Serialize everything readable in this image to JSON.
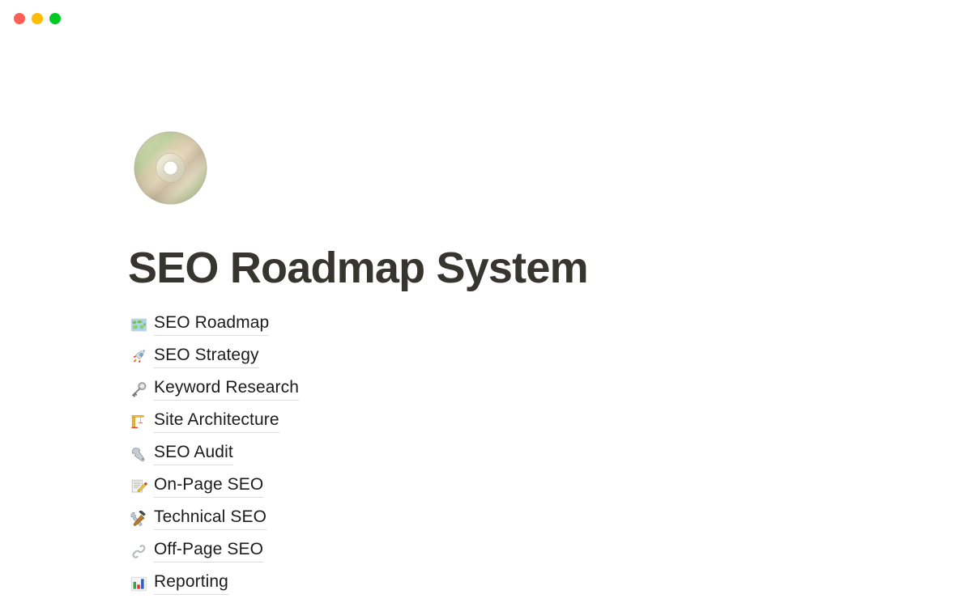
{
  "window": {
    "controls": [
      {
        "name": "close",
        "color": "#ff5f57"
      },
      {
        "name": "minimize",
        "color": "#ffbd00"
      },
      {
        "name": "maximize",
        "color": "#00ca24"
      }
    ]
  },
  "page": {
    "icon": "optical-disc-emoji",
    "title": "SEO Roadmap System",
    "title_color": "#37352f",
    "background_color": "#ffffff",
    "link_color": "#1c1c1c",
    "underline_color": "#dcdcdc"
  },
  "links": [
    {
      "emoji": "world-map-emoji",
      "label": "SEO Roadmap"
    },
    {
      "emoji": "rocket-emoji",
      "label": "SEO Strategy"
    },
    {
      "emoji": "key-emoji",
      "label": "Keyword Research"
    },
    {
      "emoji": "building-construction-emoji",
      "label": "Site Architecture"
    },
    {
      "emoji": "wrench-emoji",
      "label": "SEO Audit"
    },
    {
      "emoji": "memo-emoji",
      "label": "On-Page SEO"
    },
    {
      "emoji": "hammer-and-wrench-emoji",
      "label": "Technical SEO"
    },
    {
      "emoji": "link-emoji",
      "label": "Off-Page SEO"
    },
    {
      "emoji": "bar-chart-emoji",
      "label": "Reporting"
    }
  ]
}
